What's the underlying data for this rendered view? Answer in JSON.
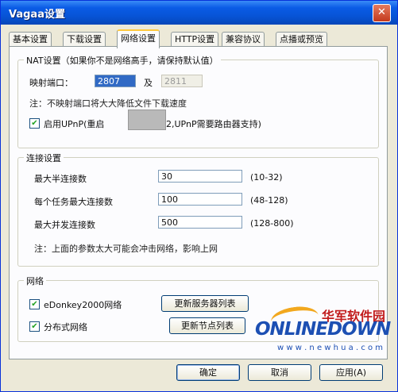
{
  "window": {
    "title": "Vagaa设置",
    "close_glyph": "✕"
  },
  "tabs": [
    {
      "label": "基本设置",
      "active": false
    },
    {
      "label": "下载设置",
      "active": false
    },
    {
      "label": "网络设置",
      "active": true
    },
    {
      "label": "HTTP设置",
      "active": false
    },
    {
      "label": "兼容协议",
      "active": false
    },
    {
      "label": "点播或预览",
      "active": false
    }
  ],
  "nat": {
    "legend": "NAT设置（如果你不是网络高手，请保持默认值）",
    "port_label": "映射端口：",
    "port_value": "2807",
    "and_label": "及",
    "port2_value": "2811",
    "note": "注：不映射端口将大大降低文件下载速度",
    "upnp_checked": true,
    "upnp_label_a": "启用UPnP(重启",
    "upnp_label_b": "2,UPnP需要路由器支持)"
  },
  "conn": {
    "legend": "连接设置",
    "rows": [
      {
        "label": "最大半连接数",
        "value": "30",
        "range": "(10-32)"
      },
      {
        "label": "每个任务最大连接数",
        "value": "100",
        "range": "(48-128)"
      },
      {
        "label": "最大并发连接数",
        "value": "500",
        "range": "(128-800)"
      }
    ],
    "note": "注：上面的参数太大可能会冲击网络，影响上网"
  },
  "network": {
    "legend": "网络",
    "edonkey_checked": true,
    "edonkey_label": "eDonkey2000网络",
    "update_servers": "更新服务器列表",
    "dht_checked": true,
    "dht_label": "分布式网络",
    "update_nodes": "更新节点列表"
  },
  "buttons": {
    "ok": "确定",
    "cancel": "取消",
    "apply": "应用(A)"
  },
  "watermark": {
    "cn": "华军软件园",
    "brand": "ONLINEDOWN",
    "url": "w w w . n e w h u a . c o m"
  },
  "icons": {
    "check": "✔"
  },
  "colors": {
    "titlebar": "#0754d6",
    "tab_highlight": "#ffc83c",
    "selection": "#316ac5"
  }
}
